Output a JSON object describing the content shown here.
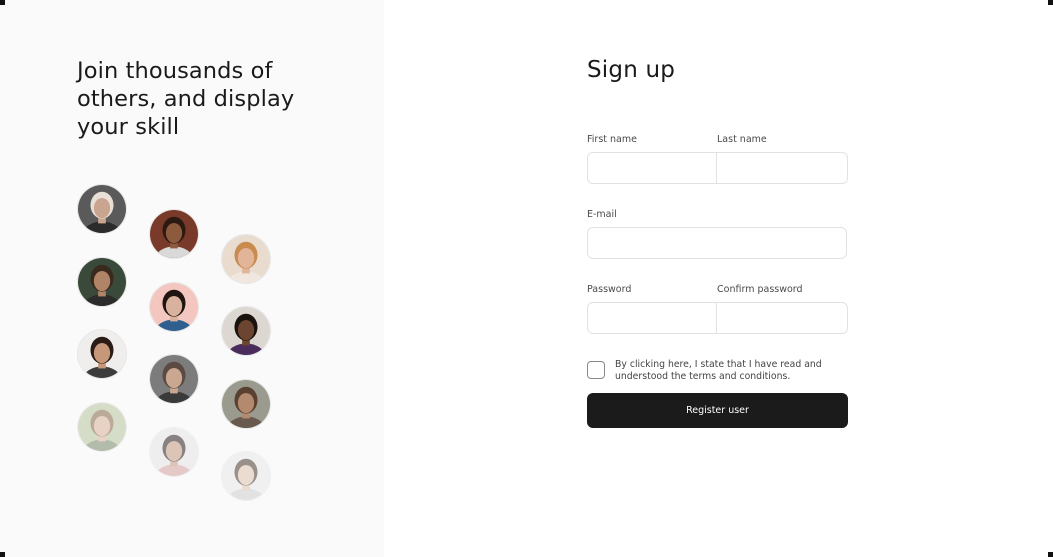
{
  "left": {
    "headline": "Join thousands of others, and display your skill",
    "avatars": [
      {
        "name": "avatar-1",
        "skin": "#c9a58f",
        "hair": "#e8e0d6",
        "bg": "#5a5a5a",
        "shirt": "#2b2b2b",
        "faded": false
      },
      {
        "name": "avatar-2",
        "skin": "#8c5a3c",
        "hair": "#2a1a12",
        "bg": "#7a3a2a",
        "shirt": "#d9d9d9",
        "faded": false
      },
      {
        "name": "avatar-3",
        "skin": "#e2b498",
        "hair": "#c98b4e",
        "bg": "#e9dccf",
        "shirt": "#f0e8de",
        "faded": false
      },
      {
        "name": "avatar-4",
        "skin": "#b08466",
        "hair": "#3a2a1e",
        "bg": "#3a4a3a",
        "shirt": "#2c2c2c",
        "faded": false
      },
      {
        "name": "avatar-5",
        "skin": "#d8b29c",
        "hair": "#1e1410",
        "bg": "#f3c7c0",
        "shirt": "#2f5f8f",
        "faded": false
      },
      {
        "name": "avatar-6",
        "skin": "#6b4530",
        "hair": "#1a120c",
        "bg": "#dcd7d0",
        "shirt": "#4a2d5a",
        "faded": false
      },
      {
        "name": "avatar-7",
        "skin": "#c7977a",
        "hair": "#2a1c14",
        "bg": "#f0eeec",
        "shirt": "#3c3c3c",
        "faded": false
      },
      {
        "name": "avatar-8",
        "skin": "#c9a791",
        "hair": "#5a4a42",
        "bg": "#7c7c7c",
        "shirt": "#3a3a3a",
        "faded": false
      },
      {
        "name": "avatar-9",
        "skin": "#b38a6e",
        "hair": "#5a4030",
        "bg": "#9a9a8e",
        "shirt": "#6a5a4e",
        "faded": false
      },
      {
        "name": "avatar-10",
        "skin": "#d9b39a",
        "hair": "#8a6a4a",
        "bg": "#b8c4a0",
        "shirt": "#7a8a6a",
        "faded": true
      },
      {
        "name": "avatar-11",
        "skin": "#c49a82",
        "hair": "#2a2020",
        "bg": "#e6e6e6",
        "shirt": "#d4a0a0",
        "faded": true
      },
      {
        "name": "avatar-12",
        "skin": "#e0c4b0",
        "hair": "#4a3a30",
        "bg": "#e8e8e8",
        "shirt": "#cfcfcf",
        "faded": true
      }
    ]
  },
  "form": {
    "title": "Sign up",
    "first_name_label": "First name",
    "first_name_value": "",
    "first_name_placeholder": "",
    "last_name_label": "Last name",
    "last_name_value": "",
    "last_name_placeholder": "",
    "email_label": "E-mail",
    "email_value": "",
    "email_placeholder": "",
    "password_label": "Password",
    "password_value": "",
    "password_placeholder": "",
    "confirm_label": "Confirm password",
    "confirm_value": "",
    "confirm_placeholder": "",
    "terms_text": "By clicking here, I state that I have read and understood the terms and conditions.",
    "terms_checked": false,
    "register_label": "Register user"
  },
  "colors": {
    "button_bg": "#1b1b1b",
    "button_text": "#ffffff",
    "left_panel_bg": "#fafafa"
  }
}
